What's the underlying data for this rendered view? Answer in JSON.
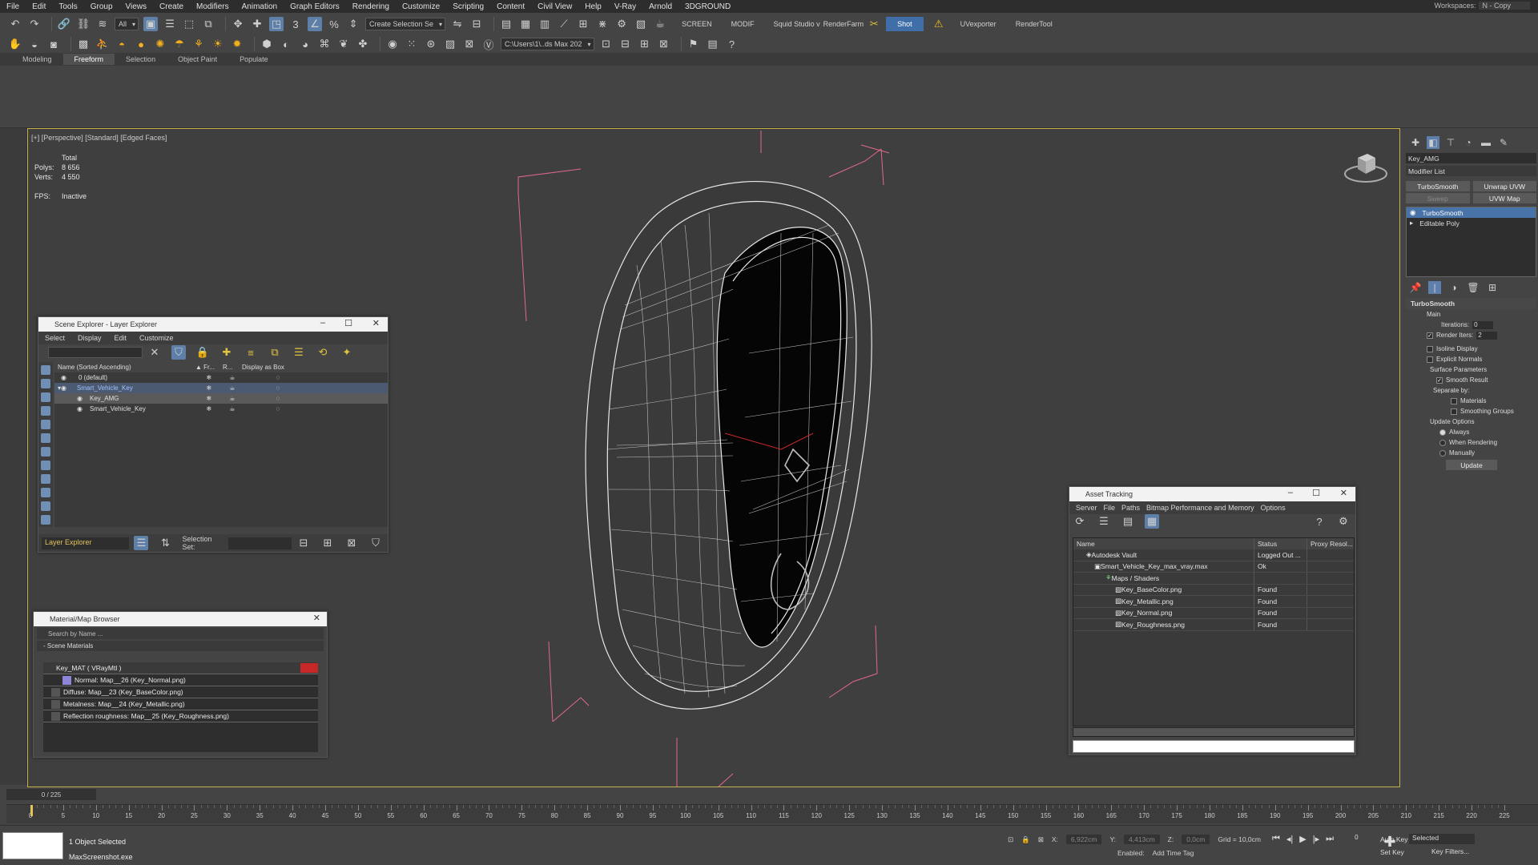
{
  "menu": [
    "File",
    "Edit",
    "Tools",
    "Group",
    "Views",
    "Create",
    "Modifiers",
    "Animation",
    "Graph Editors",
    "Rendering",
    "Customize",
    "Scripting",
    "Content",
    "Civil View",
    "Help",
    "V-Ray",
    "Arnold",
    "3DGROUND"
  ],
  "workspaces": {
    "label": "Workspaces:",
    "value": "N - Copy"
  },
  "toolbar1": {
    "filter_dropdown": "All",
    "selection_set": "Create Selection Se",
    "screen_label": "SCREEN",
    "modif_label": "MODIF",
    "squid_label": "Squid Studio v",
    "renderfarm_label": "RenderFarm",
    "shot_label": "Shot",
    "uvexporter_label": "UVexporter",
    "rendertool_label": "RenderTool"
  },
  "toolbar2": {
    "path_dropdown": "C:\\Users\\1\\..ds Max 202"
  },
  "ribbon_tabs": [
    "Modeling",
    "Freeform",
    "Selection",
    "Object Paint",
    "Populate"
  ],
  "ribbon_active": "Freeform",
  "viewport": {
    "label": "[+] [Perspective] [Standard] [Edged Faces]",
    "stats_total": "Total",
    "polys_label": "Polys:",
    "polys": "8 656",
    "verts_label": "Verts:",
    "verts": "4 550",
    "fps_label": "FPS:",
    "fps": "Inactive"
  },
  "scene_explorer": {
    "title": "Scene Explorer - Layer Explorer",
    "menu": [
      "Select",
      "Display",
      "Edit",
      "Customize"
    ],
    "columns": [
      "Name (Sorted Ascending)",
      "▲ Fr...",
      "R...",
      "Display as Box"
    ],
    "rows": [
      "0 (default)",
      "Smart_Vehicle_Key",
      "Key_AMG",
      "Smart_Vehicle_Key"
    ],
    "layer_dropdown": "Layer Explorer",
    "selection_set_label": "Selection Set:"
  },
  "material_browser": {
    "title": "Material/Map Browser",
    "search_placeholder": "Search by Name ...",
    "section": "- Scene Materials",
    "root": "Key_MAT  ( VRayMtl )",
    "items": [
      "Normal: Map__26 (Key_Normal.png)",
      "Diffuse: Map__23 (Key_BaseColor.png)",
      "Metalness: Map__24 (Key_Metallic.png)",
      "Reflection roughness: Map__25 (Key_Roughness.png)"
    ]
  },
  "asset_tracking": {
    "title": "Asset Tracking",
    "menu": [
      "Server",
      "File",
      "Paths",
      "Bitmap Performance and Memory",
      "Options"
    ],
    "columns": [
      "Name",
      "Status",
      "Proxy Resol..."
    ],
    "rows": [
      {
        "name": "Autodesk Vault",
        "status": "Logged Out ..."
      },
      {
        "name": "Smart_Vehicle_Key_max_vray.max",
        "status": "Ok"
      },
      {
        "name": "Maps / Shaders",
        "status": ""
      },
      {
        "name": "Key_BaseColor.png",
        "status": "Found"
      },
      {
        "name": "Key_Metallic.png",
        "status": "Found"
      },
      {
        "name": "Key_Normal.png",
        "status": "Found"
      },
      {
        "name": "Key_Roughness.png",
        "status": "Found"
      }
    ]
  },
  "command_panel": {
    "object_name": "Key_AMG",
    "modifier_list": "Modifier List",
    "buttons": [
      "TurboSmooth",
      "Unwrap UVW",
      "Sweep",
      "UVW Map"
    ],
    "stack": [
      "TurboSmooth",
      "Editable Poly"
    ],
    "rollout_title": "TurboSmooth",
    "main_label": "Main",
    "iterations_label": "Iterations:",
    "iterations": "0",
    "render_iters_label": "Render Iters:",
    "render_iters": "2",
    "isoline": "Isoline Display",
    "explicit_normals": "Explicit Normals",
    "surface_params": "Surface Parameters",
    "smooth_result": "Smooth Result",
    "separate_by": "Separate by:",
    "materials": "Materials",
    "smoothing_groups": "Smoothing Groups",
    "update_options": "Update Options",
    "always": "Always",
    "when_rendering": "When Rendering",
    "manually": "Manually",
    "update_btn": "Update"
  },
  "timeline": {
    "frame": "0 / 225",
    "ticks": [
      "0",
      "5",
      "10",
      "15",
      "20",
      "25",
      "30",
      "35",
      "40",
      "45",
      "50",
      "55",
      "60",
      "65",
      "70",
      "75",
      "80",
      "85",
      "90",
      "95",
      "100",
      "105",
      "110",
      "115",
      "120",
      "125",
      "130",
      "135",
      "140",
      "145",
      "150",
      "155",
      "160",
      "165",
      "170",
      "175",
      "180",
      "185",
      "190",
      "195",
      "200",
      "205",
      "210",
      "215",
      "220",
      "225"
    ]
  },
  "status": {
    "selected": "1 Object Selected",
    "script": "MaxScreenshot.exe",
    "x_label": "X:",
    "x": "6,922cm",
    "y_label": "Y:",
    "y": "4,413cm",
    "z_label": "Z:",
    "z": "0,0cm",
    "grid": "Grid = 10,0cm",
    "enabled": "Enabled:",
    "add_time_tag": "Add Time Tag",
    "auto_key": "Auto Key",
    "set_key": "Set Key",
    "selected_dropdown": "Selected",
    "key_filters": "Key Filters...",
    "frame_field": "0"
  }
}
